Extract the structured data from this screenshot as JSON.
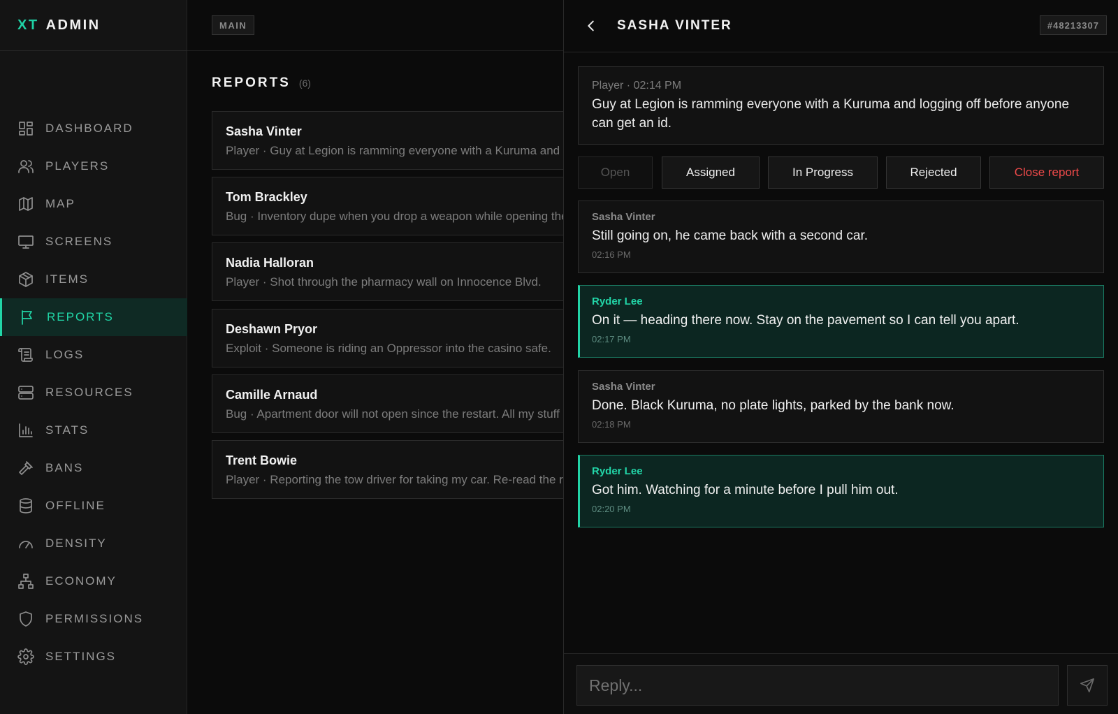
{
  "brand": {
    "prefix": "XT",
    "name": "ADMIN"
  },
  "sidebar": {
    "items": [
      {
        "label": "DASHBOARD",
        "icon": "grid-icon"
      },
      {
        "label": "PLAYERS",
        "icon": "users-icon"
      },
      {
        "label": "MAP",
        "icon": "map-icon"
      },
      {
        "label": "SCREENS",
        "icon": "monitor-icon"
      },
      {
        "label": "ITEMS",
        "icon": "box-icon"
      },
      {
        "label": "REPORTS",
        "icon": "flag-icon",
        "active": true
      },
      {
        "label": "LOGS",
        "icon": "scroll-icon"
      },
      {
        "label": "RESOURCES",
        "icon": "server-icon"
      },
      {
        "label": "STATS",
        "icon": "bar-chart-icon"
      },
      {
        "label": "BANS",
        "icon": "hammer-icon"
      },
      {
        "label": "OFFLINE",
        "icon": "database-icon"
      },
      {
        "label": "DENSITY",
        "icon": "gauge-icon"
      },
      {
        "label": "ECONOMY",
        "icon": "hierarchy-icon"
      },
      {
        "label": "PERMISSIONS",
        "icon": "shield-icon"
      },
      {
        "label": "SETTINGS",
        "icon": "gear-icon"
      }
    ]
  },
  "main": {
    "crumb": "MAIN",
    "title": "REPORTS",
    "count": "(6)",
    "reports": [
      {
        "name": "Sasha Vinter",
        "preview": "Player · Guy at Legion is ramming everyone with a Kuruma and logging off before anyone can get an id."
      },
      {
        "name": "Tom Brackley",
        "preview": "Bug · Inventory dupe when you drop a weapon while opening the trunk."
      },
      {
        "name": "Nadia Halloran",
        "preview": "Player · Shot through the pharmacy wall on Innocence Blvd."
      },
      {
        "name": "Deshawn Pryor",
        "preview": "Exploit · Someone is riding an Oppressor into the casino safe."
      },
      {
        "name": "Camille Arnaud",
        "preview": "Bug · Apartment door will not open since the restart. All my stuff is inside."
      },
      {
        "name": "Trent Bowie",
        "preview": "Player · Reporting the tow driver for taking my car. Re-read the rules."
      }
    ]
  },
  "detail": {
    "title": "SASHA VINTER",
    "report_id": "#48213307",
    "original": {
      "meta": "Player · 02:14 PM",
      "text": "Guy at Legion is ramming everyone with a Kuruma and logging off before anyone can get an id."
    },
    "status_buttons": [
      {
        "label": "Open",
        "state": "disabled"
      },
      {
        "label": "Assigned",
        "state": "normal"
      },
      {
        "label": "In Progress",
        "state": "normal"
      },
      {
        "label": "Rejected",
        "state": "normal"
      },
      {
        "label": "Close report",
        "state": "danger"
      }
    ],
    "messages": [
      {
        "author": "Sasha Vinter",
        "text": "Still going on, he came back with a second car.",
        "time": "02:16 PM",
        "staff": false
      },
      {
        "author": "Ryder Lee",
        "text": "On it — heading there now. Stay on the pavement so I can tell you apart.",
        "time": "02:17 PM",
        "staff": true
      },
      {
        "author": "Sasha Vinter",
        "text": "Done. Black Kuruma, no plate lights, parked by the bank now.",
        "time": "02:18 PM",
        "staff": false
      },
      {
        "author": "Ryder Lee",
        "text": "Got him. Watching for a minute before I pull him out.",
        "time": "02:20 PM",
        "staff": true
      }
    ],
    "reply_placeholder": "Reply...",
    "send_icon": "send-icon"
  },
  "colors": {
    "accent": "#21d6a7",
    "danger": "#ef4a4a",
    "background": "#0a0a0a",
    "panel": "#141414"
  }
}
